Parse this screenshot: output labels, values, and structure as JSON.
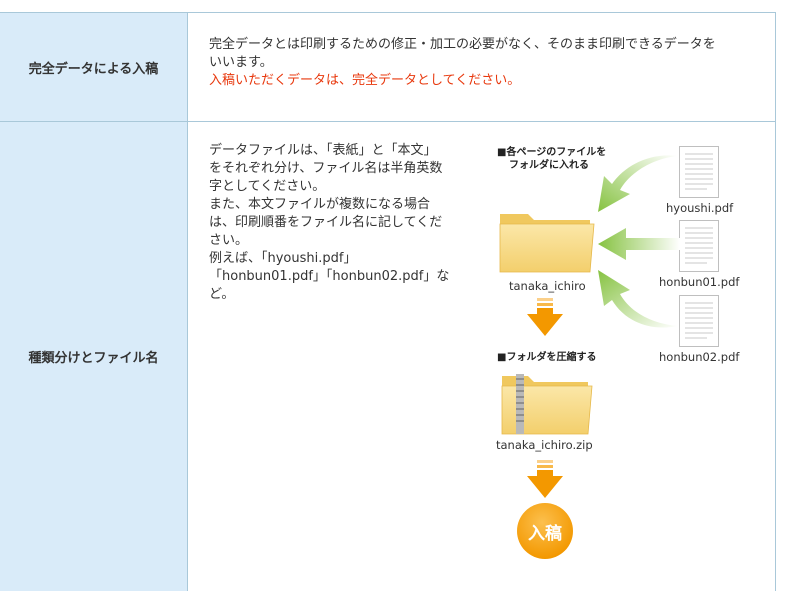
{
  "rows": [
    {
      "label": "完全データによる入稿",
      "text_line1": "完全データとは印刷するための修正・加工の必要がなく、そのまま印刷できるデータを",
      "text_line2": "いいます。",
      "note": "入稿いただくデータは、完全データとしてください。"
    },
    {
      "label": "種類分けとファイル名",
      "lines": [
        "データファイルは、「表紙」と「本文」",
        "をそれぞれ分け、ファイル名は半角英数",
        "字としてください。",
        "また、本文ファイルが複数になる場合",
        "は、印刷順番をファイル名に記してくだ",
        "さい。",
        "例えば、「hyoushi.pdf」",
        "「honbun01.pdf」「honbun02.pdf」な",
        "ど。"
      ]
    }
  ],
  "diagram": {
    "step1_heading_line1": "■各ページのファイルを",
    "step1_heading_line2": "フォルダに入れる",
    "folder_name": "tanaka_ichiro",
    "files": [
      "hyoushi.pdf",
      "honbun01.pdf",
      "honbun02.pdf"
    ],
    "step2_heading": "■フォルダを圧縮する",
    "zip_name": "tanaka_ichiro.zip",
    "submit_label": "入稿"
  },
  "colors": {
    "label_bg": "#d9ebf9",
    "border": "#a9c8d9",
    "note_red": "#e8380d",
    "arrow_green": "#8cc63f",
    "arrow_orange": "#f39800",
    "folder": "#f8dd8c"
  }
}
